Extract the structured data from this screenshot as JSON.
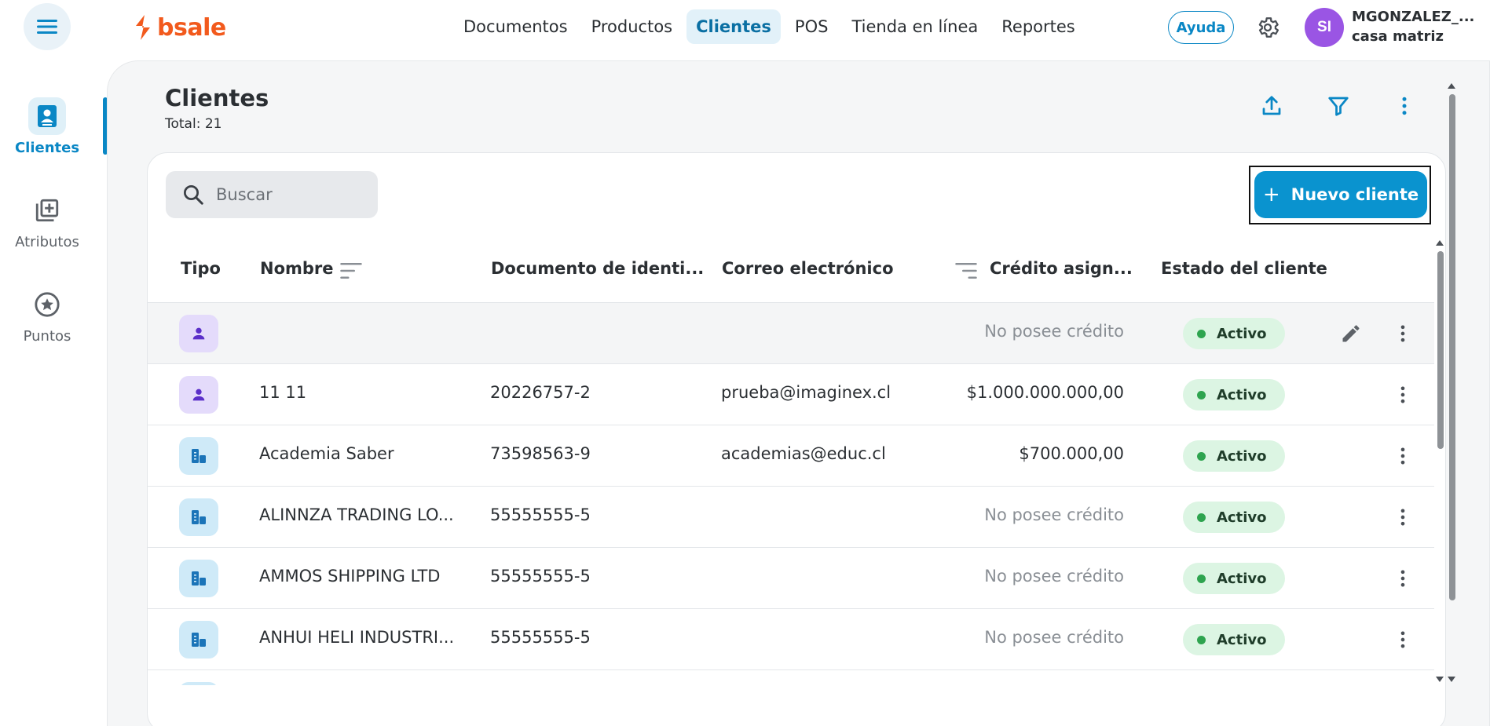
{
  "app": {
    "logo_text": "bsale",
    "brand_color": "#f25a1d",
    "accent_color": "#0a93cf"
  },
  "nav": {
    "items": [
      {
        "label": "Documentos",
        "active": false
      },
      {
        "label": "Productos",
        "active": false
      },
      {
        "label": "Clientes",
        "active": true
      },
      {
        "label": "POS",
        "active": false
      },
      {
        "label": "Tienda en línea",
        "active": false
      },
      {
        "label": "Reportes",
        "active": false
      }
    ],
    "help_label": "Ayuda"
  },
  "user": {
    "initials": "SI",
    "name": "MGONZALEZ_...",
    "branch": "casa matriz"
  },
  "sidebar": {
    "items": [
      {
        "label": "Clientes",
        "icon": "contact-card-icon",
        "active": true
      },
      {
        "label": "Atributos",
        "icon": "library-add-icon",
        "active": false
      },
      {
        "label": "Puntos",
        "icon": "star-circle-icon",
        "active": false
      }
    ]
  },
  "page": {
    "title": "Clientes",
    "total": "Total: 21",
    "search_placeholder": "Buscar",
    "new_button_label": "Nuevo cliente",
    "new_button_plus": "+"
  },
  "table": {
    "columns": {
      "type": "Tipo",
      "name": "Nombre",
      "document": "Documento de identi...",
      "email": "Correo electrónico",
      "credit": "Crédito asign...",
      "status": "Estado del cliente"
    },
    "rows": [
      {
        "type": "person",
        "name": "",
        "document": "",
        "email": "",
        "credit": "No posee crédito",
        "has_credit": false,
        "status": "Activo"
      },
      {
        "type": "person",
        "name": "11 11",
        "document": "20226757-2",
        "email": "prueba@imaginex.cl",
        "credit": "$1.000.000.000,00",
        "has_credit": true,
        "status": "Activo"
      },
      {
        "type": "company",
        "name": "Academia Saber",
        "document": "73598563-9",
        "email": "academias@educ.cl",
        "credit": "$700.000,00",
        "has_credit": true,
        "status": "Activo"
      },
      {
        "type": "company",
        "name": "ALINNZA TRADING LO...",
        "document": "55555555-5",
        "email": "",
        "credit": "No posee crédito",
        "has_credit": false,
        "status": "Activo"
      },
      {
        "type": "company",
        "name": "AMMOS SHIPPING LTD",
        "document": "55555555-5",
        "email": "",
        "credit": "No posee crédito",
        "has_credit": false,
        "status": "Activo"
      },
      {
        "type": "company",
        "name": "ANHUI HELI INDUSTRI...",
        "document": "55555555-5",
        "email": "",
        "credit": "No posee crédito",
        "has_credit": false,
        "status": "Activo"
      }
    ]
  }
}
